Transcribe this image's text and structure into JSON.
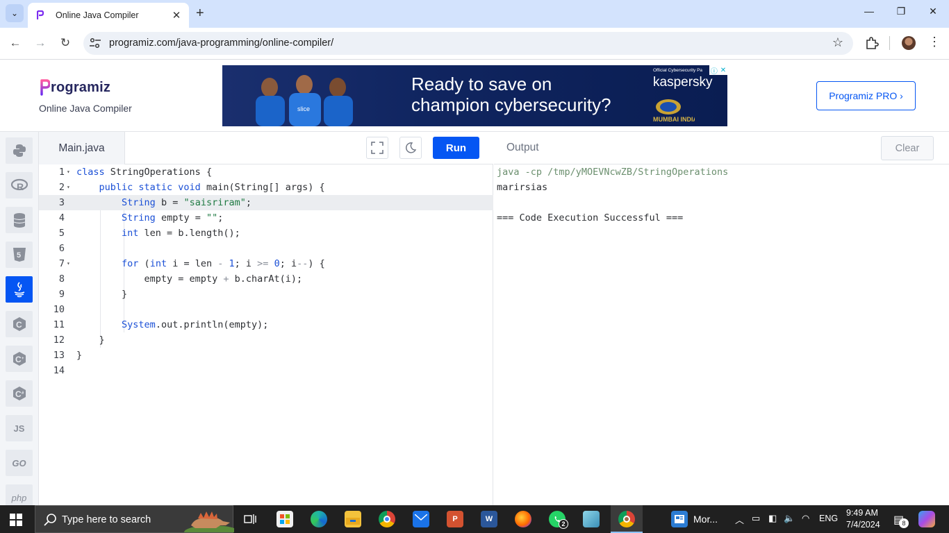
{
  "browser": {
    "tab_title": "Online Java Compiler",
    "tab_close": "✕",
    "new_tab": "+",
    "url": "programiz.com/java-programming/online-compiler/",
    "minimize": "—",
    "restore": "❐",
    "close": "✕"
  },
  "site": {
    "logo_text": "rogramiz",
    "subtitle": "Online Java Compiler",
    "pro_button": "Programiz PRO ›",
    "ad": {
      "headline_line1": "Ready to save on",
      "headline_line2": "champion cybersecurity?",
      "sponsor_small": "Official Cybersecurity Pa",
      "brand": "kaspersky",
      "team": "MUMBAI INDIANS"
    }
  },
  "sidebar": {
    "languages": [
      "python-icon",
      "r-icon",
      "sql-icon",
      "html5-icon",
      "java-icon",
      "c-icon",
      "cpp-icon",
      "csharp-icon",
      "js-icon",
      "go-icon",
      "php-icon"
    ],
    "labels": {
      "js": "JS",
      "go": "GO",
      "php": "php"
    }
  },
  "editor": {
    "file_name": "Main.java",
    "run_label": "Run",
    "lines": [
      "class StringOperations {",
      "    public static void main(String[] args) {",
      "        String b = \"saisriram\";",
      "        String empty = \"\";",
      "        int len = b.length();",
      "",
      "        for (int i = len - 1; i >= 0; i--) {",
      "            empty = empty + b.charAt(i);",
      "        }",
      "",
      "        System.out.println(empty);",
      "    }",
      "}",
      ""
    ],
    "active_line": 3
  },
  "output": {
    "title": "Output",
    "clear_label": "Clear",
    "lines": [
      "java -cp /tmp/yMOEVNcwZB/StringOperations",
      "marirsias",
      "",
      "=== Code Execution Successful ==="
    ]
  },
  "taskbar": {
    "search_placeholder": "Type here to search",
    "whatsapp_badge": "2",
    "mail_app_label": "Mor...",
    "lang": "ENG",
    "time": "9:49 AM",
    "date": "7/4/2024",
    "notifications": "8"
  }
}
